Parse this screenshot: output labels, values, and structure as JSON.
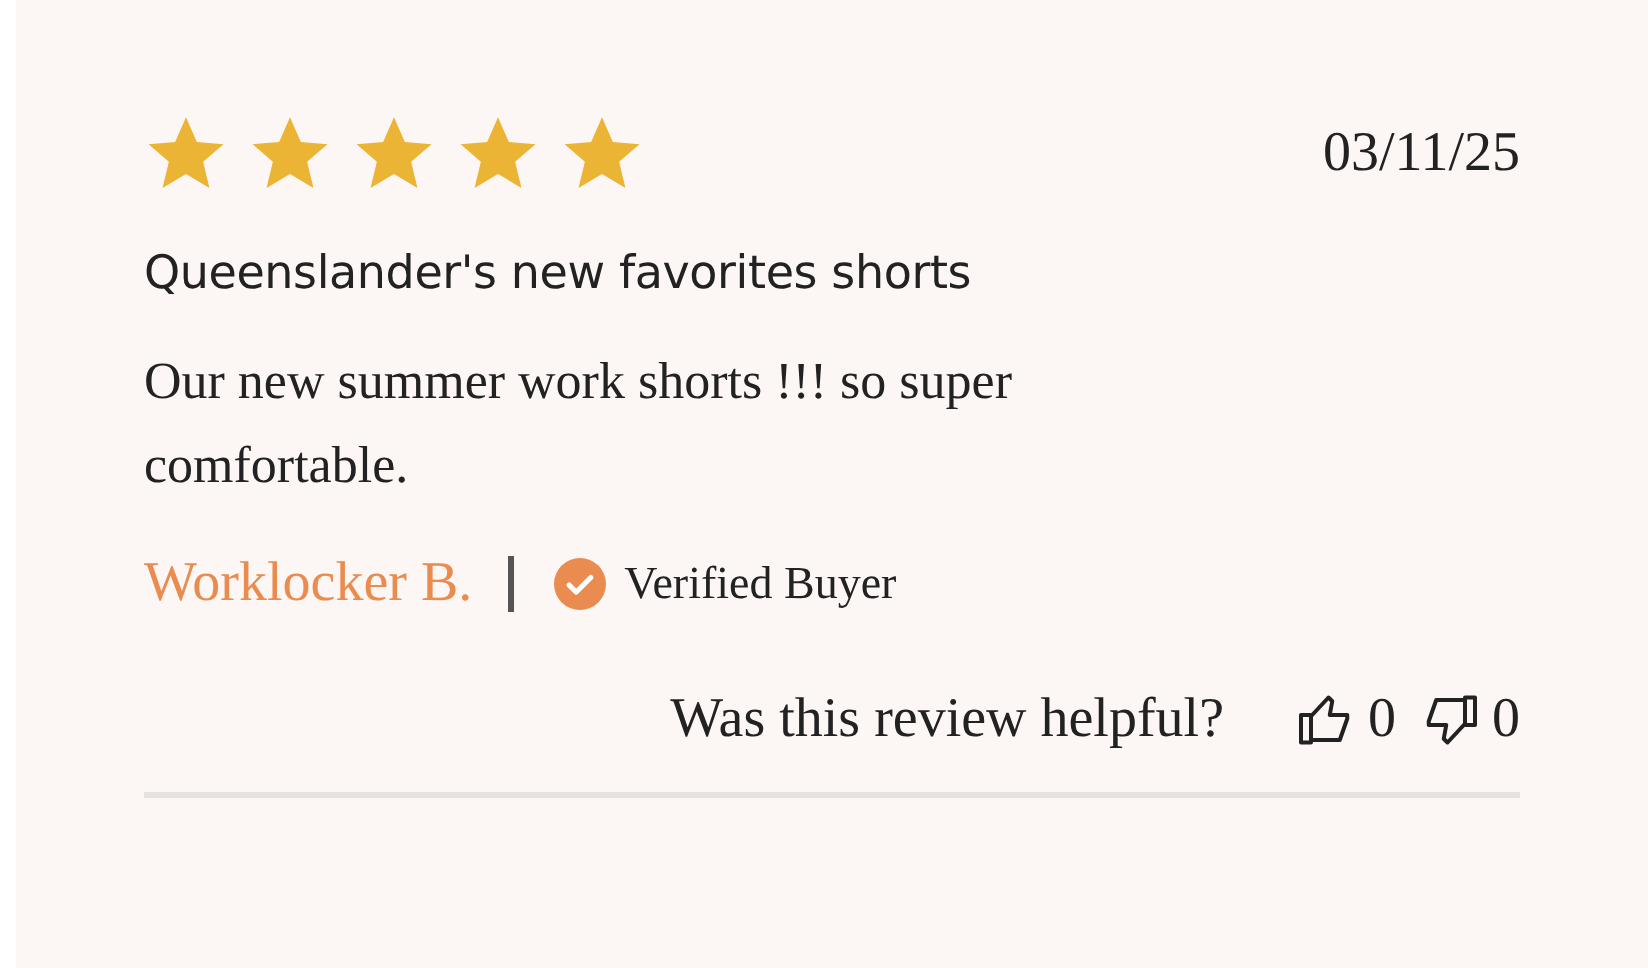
{
  "review": {
    "stars": 5,
    "date": "03/11/25",
    "title": "Queenslander's new favorites shorts",
    "body": "Our new summer work shorts !!! so super comfortable.",
    "author": "Worklocker B.",
    "verified": true,
    "verified_label": "Verified Buyer",
    "helpful": {
      "question": "Was this review helpful?",
      "up_count": "0",
      "down_count": "0"
    }
  }
}
